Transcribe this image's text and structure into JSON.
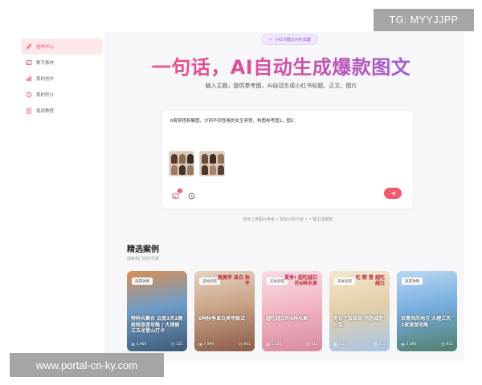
{
  "sidebar": {
    "items": [
      {
        "label": "创作中心",
        "icon": "pen-icon",
        "active": true
      },
      {
        "label": "数字素材",
        "icon": "image-icon",
        "active": false
      },
      {
        "label": "我的创作",
        "icon": "bars-icon",
        "active": false
      },
      {
        "label": "我的积分",
        "icon": "clock-icon",
        "active": false
      },
      {
        "label": "使用教程",
        "icon": "document-icon",
        "active": false
      }
    ]
  },
  "hero": {
    "pill": "小红书图文AI生成器",
    "title": "一句话，AI自动生成爆款图文",
    "subtitle": "输入主题，提供参考图，AI自动生成小红书标题、正文、图片"
  },
  "input": {
    "prompt": "6套穿搭拆解图，分别不同性格的女生穿搭，构图参考图1，图2",
    "image_count": "2"
  },
  "hint": "支持上传图片参考 • 智能分析内容 • 一键生成爆款",
  "featured": {
    "title": "精选案例",
    "subtitle": "探索热门创作灵感"
  },
  "cards": [
    {
      "tag": "旅游攻略",
      "top_text": "",
      "caption": "特种兵集合 云南3天2晚极限旅游攻略 | 大理丽江玉龙雪山打卡",
      "views": "4,960",
      "likes": "321",
      "colors": [
        "#6f9cc7",
        "#d98f55",
        "#3c5a78"
      ]
    },
    {
      "tag": "美妆穿搭",
      "top_text": "姜黄甲 显白 秋冬",
      "caption": "6种秋季显白美甲款式",
      "views": "7,990",
      "likes": "841",
      "colors": [
        "#c9a387",
        "#e6d2c1",
        "#8a5b48"
      ]
    },
    {
      "tag": "美食穿搭",
      "top_text": "夏季! 超吃越白的6种水果",
      "caption": "越吃越白的6种水果",
      "views": "5,120",
      "likes": "612",
      "colors": [
        "#f2b7c4",
        "#f7dce3",
        "#d98aa0"
      ]
    },
    {
      "tag": "美食穿搭",
      "top_text": "吃 精 雪 越吃越白",
      "caption": "冬日下饭菜单 消脂减肥好菜",
      "views": "2,241",
      "likes": "318",
      "colors": [
        "#e3cfa8",
        "#f4e8d2",
        "#a8c6e8"
      ]
    },
    {
      "tag": "旅游攻略",
      "top_text": "",
      "caption": "去青风的地方 大理三天2夜旅游攻略",
      "views": "3,860",
      "likes": "851",
      "colors": [
        "#78aee0",
        "#b9d8f0",
        "#4f7f6a"
      ]
    }
  ],
  "watermarks": {
    "top": "TG: MYYJJPP",
    "bottom": "www.portal-cn-ky.com"
  }
}
